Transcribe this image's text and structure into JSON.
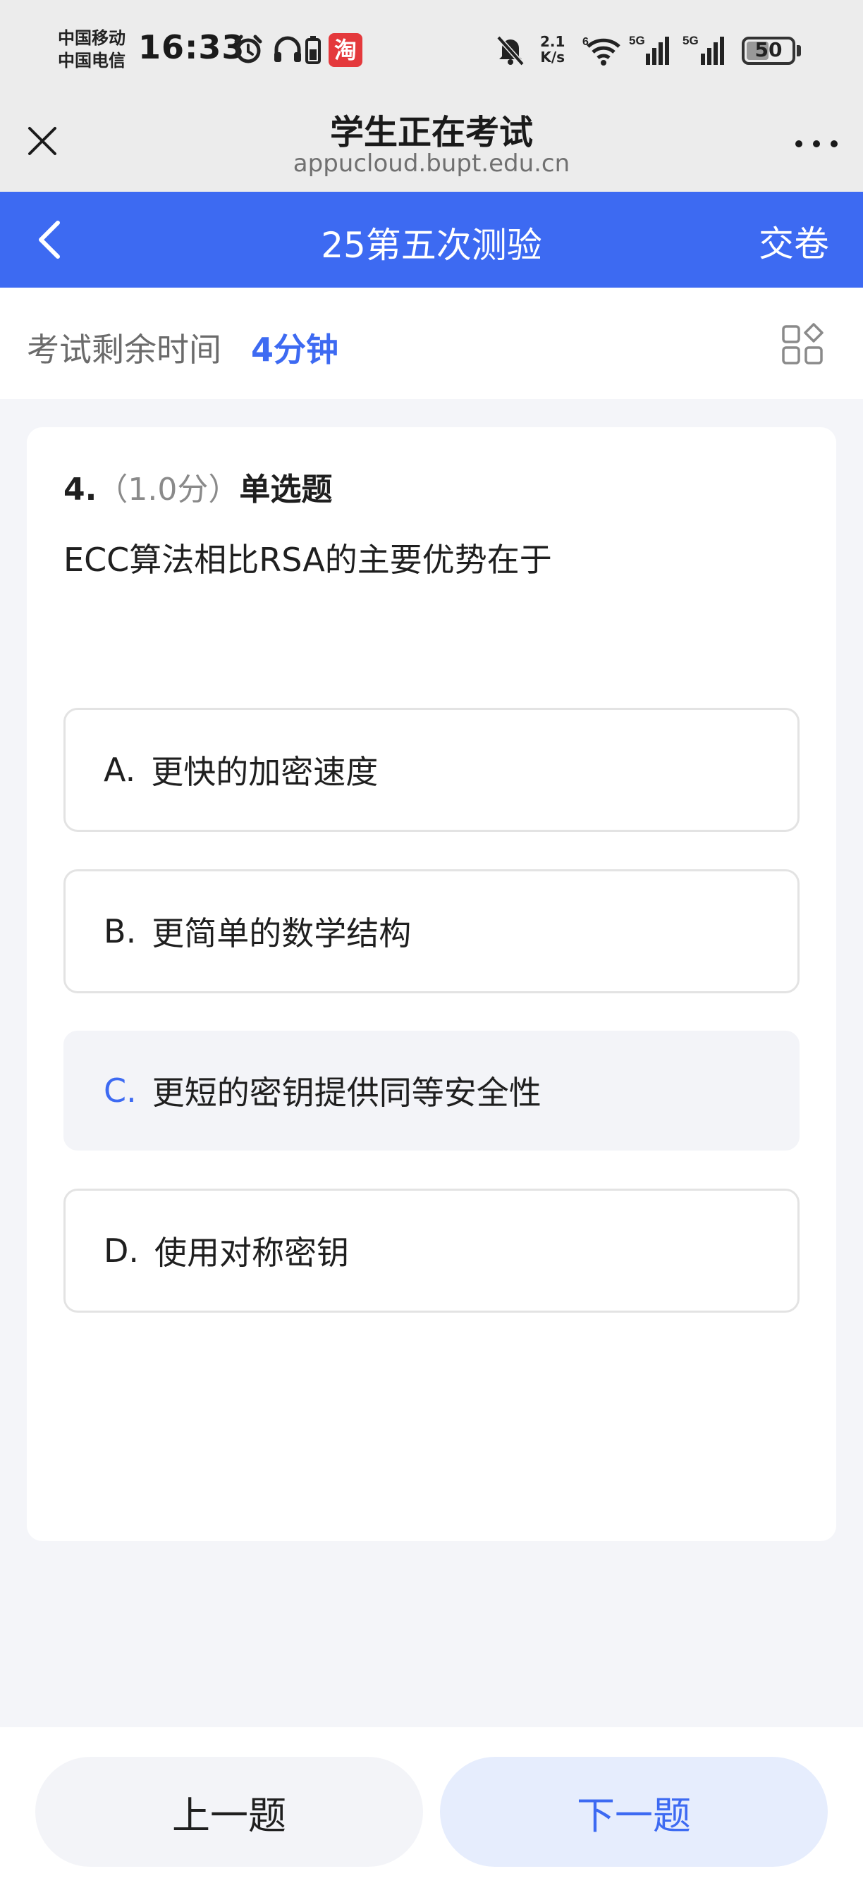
{
  "status_bar": {
    "carrier_1": "中国移动",
    "carrier_2": "中国电信",
    "time": "16:33",
    "taobao_glyph": "淘",
    "net_speed_value": "2.1",
    "net_speed_unit": "K/s",
    "wifi_badge": "6",
    "signal_1_label": "5G",
    "signal_2_label": "5G",
    "battery_level": "50",
    "battery_fraction": 0.5
  },
  "browser": {
    "title": "学生正在考试",
    "url": "appucloud.bupt.edu.cn"
  },
  "nav": {
    "title": "25第五次测验",
    "submit_label": "交卷"
  },
  "timer": {
    "label": "考试剩余时间",
    "value": "4分钟"
  },
  "question": {
    "number": "4.",
    "score": "（1.0分）",
    "type": "单选题",
    "text": "ECC算法相比RSA的主要优势在于",
    "options": [
      {
        "letter": "A",
        "sep": ".",
        "text": "更快的加密速度",
        "selected": false
      },
      {
        "letter": "B",
        "sep": ".",
        "text": "更简单的数学结构",
        "selected": false
      },
      {
        "letter": "C",
        "sep": ".",
        "text": "更短的密钥提供同等安全性",
        "selected": true
      },
      {
        "letter": "D",
        "sep": ".",
        "text": "使用对称密钥",
        "selected": false
      }
    ]
  },
  "footer": {
    "prev_label": "上一题",
    "next_label": "下一题"
  },
  "colors": {
    "accent": "#3d6af2",
    "selected_bg": "#f3f4f8",
    "next_btn_bg": "#e6edfd"
  },
  "icons": [
    "close-icon",
    "more-icon",
    "back-chevron-icon",
    "answer-sheet-grid-icon",
    "alarm-icon",
    "headphones-icon",
    "battery-small-icon",
    "taobao-icon",
    "mute-bell-icon",
    "wifi-icon",
    "signal-icon",
    "battery-icon"
  ]
}
